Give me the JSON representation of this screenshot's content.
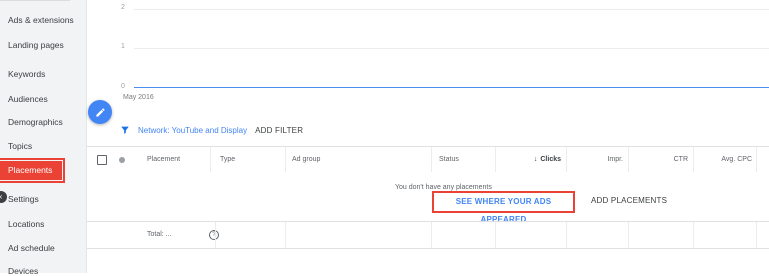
{
  "sidebar": {
    "items": [
      {
        "label": "Ads & extensions"
      },
      {
        "label": "Landing pages"
      },
      {
        "label": "Keywords"
      },
      {
        "label": "Audiences"
      },
      {
        "label": "Demographics"
      },
      {
        "label": "Topics"
      },
      {
        "label": "Placements",
        "active": true
      },
      {
        "label": "Settings"
      },
      {
        "label": "Locations"
      },
      {
        "label": "Ad schedule"
      },
      {
        "label": "Devices"
      }
    ]
  },
  "chart_data": {
    "type": "line",
    "y_ticks": [
      "2",
      "1",
      "0"
    ],
    "x_ticks": [
      "May 2016"
    ],
    "ylim": [
      0,
      2
    ],
    "series": [
      {
        "values": [
          0,
          0
        ]
      }
    ],
    "colors": {
      "line": "#4a8ef0"
    }
  },
  "filter": {
    "network_label": "Network: YouTube and Display",
    "add_filter": "ADD FILTER"
  },
  "table": {
    "headers": {
      "placement": "Placement",
      "type": "Type",
      "ad_group": "Ad group",
      "status": "Status",
      "clicks": "Clicks",
      "impr": "Impr.",
      "ctr": "CTR",
      "avg_cpc": "Avg. CPC"
    },
    "sort": {
      "column": "clicks",
      "direction": "descending"
    },
    "empty_message": "You don't have any placements",
    "see_where_button": "SEE WHERE YOUR ADS APPEARED",
    "add_placements": "ADD PLACEMENTS",
    "total_label": "Total: ..."
  },
  "colors": {
    "accent": "#4285f4",
    "highlight": "#ea4335"
  },
  "icons": {
    "fab": "pencil-icon",
    "filter": "funnel-icon",
    "sort": "arrow-down-icon",
    "help": "help-circle-icon"
  }
}
